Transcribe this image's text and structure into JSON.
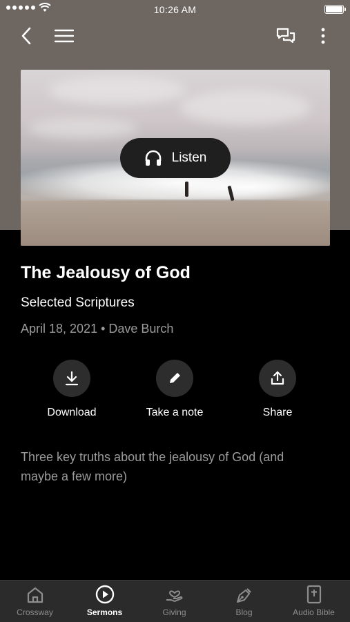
{
  "status_bar": {
    "time": "10:26 AM"
  },
  "header": {
    "back_icon": "chevron-left-icon",
    "menu_icon": "hamburger-icon",
    "chat_icon": "chat-bubbles-icon",
    "more_icon": "vertical-dots-icon"
  },
  "hero": {
    "listen_label": "Listen",
    "listen_icon": "headphones-icon"
  },
  "sermon": {
    "title": "The Jealousy of God",
    "scripture": "Selected Scriptures",
    "meta": "April 18, 2021 • Dave Burch",
    "description": "Three key truths about the jealousy of God (and maybe a few more)"
  },
  "actions": [
    {
      "label": "Download",
      "icon": "download-icon"
    },
    {
      "label": "Take a note",
      "icon": "pencil-icon"
    },
    {
      "label": "Share",
      "icon": "share-icon"
    }
  ],
  "tabs": [
    {
      "label": "Crossway",
      "icon": "home-icon",
      "active": false
    },
    {
      "label": "Sermons",
      "icon": "play-circle-icon",
      "active": true
    },
    {
      "label": "Giving",
      "icon": "giving-hand-icon",
      "active": false
    },
    {
      "label": "Blog",
      "icon": "pen-nib-icon",
      "active": false
    },
    {
      "label": "Audio Bible",
      "icon": "bible-icon",
      "active": false
    }
  ],
  "colors": {
    "header_bg": "#6e6661",
    "background": "#000000",
    "tab_bar_bg": "#2b2b2b",
    "action_circle": "#2d2d2d",
    "muted_text": "#9b9b9b"
  }
}
